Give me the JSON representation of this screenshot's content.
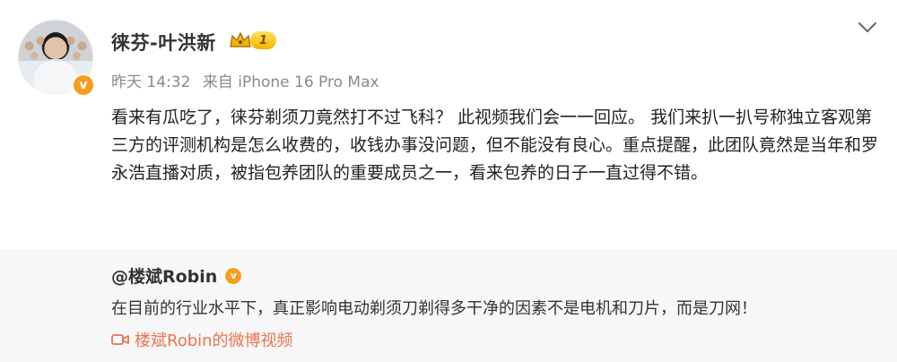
{
  "post": {
    "author": "徕芬-叶洪新",
    "vip_level": "1",
    "time": "昨天 14:32",
    "source": "来自 iPhone 16 Pro Max",
    "text": "看来有瓜吃了，徕芬剃须刀竟然打不过飞科？ 此视频我们会一一回应。 我们来扒一扒号称独立客观第三方的评测机构是怎么收费的，收钱办事没问题，但不能没有良心。重点提醒，此团队竟然是当年和罗永浩直播对质，被指包养团队的重要成员之一，看来包养的日子一直过得不错。"
  },
  "repost": {
    "author": "@楼斌Robin",
    "text": "在目前的行业水平下，真正影响电动剃须刀剃得多干净的因素不是电机和刀片，而是刀网！",
    "video_link": "楼斌Robin的微博视频"
  },
  "colors": {
    "accent": "#eb7350",
    "badge": "#f79d1c",
    "repost_bg": "#f7f7f7"
  }
}
